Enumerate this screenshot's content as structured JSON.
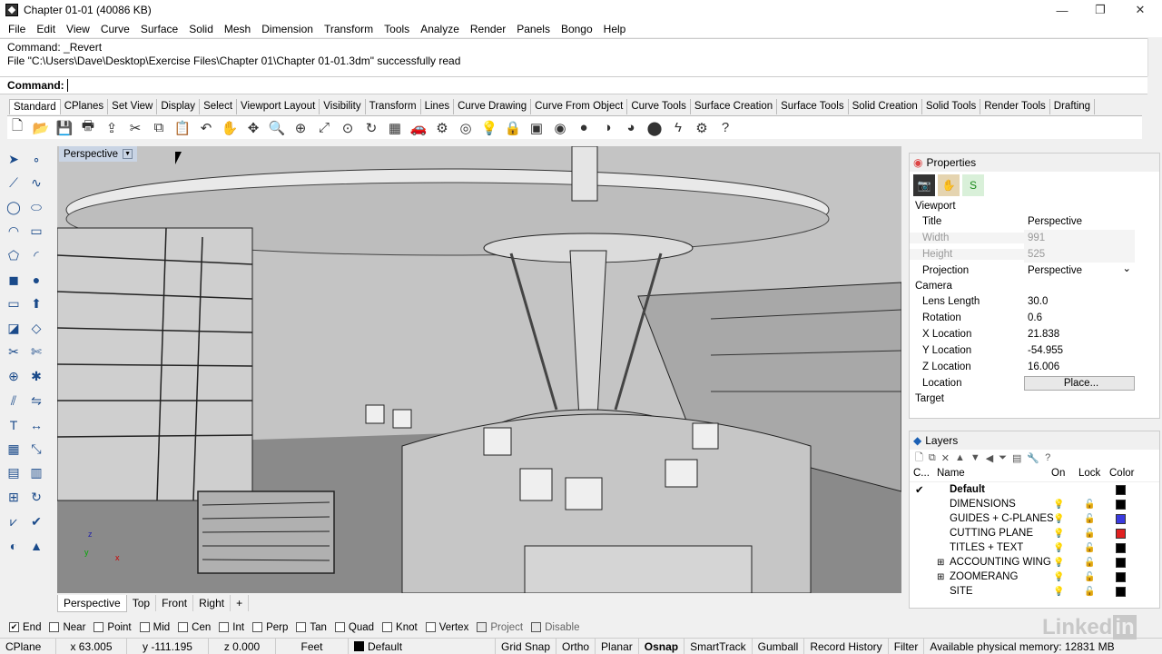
{
  "window": {
    "title": "Chapter 01-01 (40086 KB)",
    "minimize": "—",
    "restore": "❐",
    "close": "✕"
  },
  "menu": [
    "File",
    "Edit",
    "View",
    "Curve",
    "Surface",
    "Solid",
    "Mesh",
    "Dimension",
    "Transform",
    "Tools",
    "Analyze",
    "Render",
    "Panels",
    "Bongo",
    "Help"
  ],
  "command": {
    "history": [
      "Command: _Revert",
      "File \"C:\\Users\\Dave\\Desktop\\Exercise Files\\Chapter 01\\Chapter 01-01.3dm\" successfully read"
    ],
    "prompt": "Command:"
  },
  "toolbar_tabs": [
    "Standard",
    "CPlanes",
    "Set View",
    "Display",
    "Select",
    "Viewport Layout",
    "Visibility",
    "Transform",
    "Lines",
    "Curve Drawing",
    "Curve From Object",
    "Curve Tools",
    "Surface Creation",
    "Surface Tools",
    "Solid Creation",
    "Solid Tools",
    "Render Tools",
    "Drafting"
  ],
  "toolbar_icons": [
    "new-icon",
    "open-icon",
    "save-icon",
    "print-icon",
    "import-icon",
    "cut-icon",
    "copy-icon",
    "paste-icon",
    "undo-icon",
    "pan-icon",
    "move-icon",
    "zoom-icon",
    "zoom-window-icon",
    "zoom-extents-icon",
    "zoom-selected-icon",
    "rotate-view-icon",
    "four-viewports-icon",
    "car-icon",
    "render-options-icon",
    "cplane-icon",
    "light-icon",
    "lock-icon",
    "material-icon",
    "color-wheel-icon",
    "shade-icon",
    "rendered-icon",
    "ghosted-icon",
    "sphere-icon",
    "lightning-icon",
    "options-gear-icon",
    "help-icon"
  ],
  "toolbar_glyphs": [
    "🗋",
    "📂",
    "💾",
    "🖶",
    "⇪",
    "✂",
    "⧉",
    "📋",
    "↶",
    "✋",
    "✥",
    "🔍",
    "⊕",
    "⤢",
    "⊙",
    "↻",
    "▦",
    "🚗",
    "⚙",
    "◎",
    "💡",
    "🔒",
    "▣",
    "◉",
    "●",
    "◑",
    "◕",
    "⬤",
    "ϟ",
    "⚙",
    "?"
  ],
  "viewport": {
    "title": "Perspective",
    "dropdown": "▼",
    "axis": {
      "z": "z",
      "y": "y",
      "x": "x"
    }
  },
  "view_tabs": [
    "Perspective",
    "Top",
    "Front",
    "Right",
    "+"
  ],
  "properties": {
    "header": "Properties",
    "sections": {
      "viewport": "Viewport",
      "camera": "Camera",
      "target": "Target"
    },
    "viewport_rows": [
      {
        "k": "Title",
        "v": "Perspective"
      },
      {
        "k": "Width",
        "v": "991"
      },
      {
        "k": "Height",
        "v": "525"
      },
      {
        "k": "Projection",
        "v": "Perspective"
      }
    ],
    "camera_rows": [
      {
        "k": "Lens Length",
        "v": "30.0"
      },
      {
        "k": "Rotation",
        "v": "0.6"
      },
      {
        "k": "X Location",
        "v": "21.838"
      },
      {
        "k": "Y Location",
        "v": "-54.955"
      },
      {
        "k": "Z Location",
        "v": "16.006"
      },
      {
        "k": "Location",
        "v": "Place..."
      }
    ]
  },
  "layers": {
    "header": "Layers",
    "columns": [
      "C...",
      "Name",
      "On",
      "Lock",
      "Color"
    ],
    "rows": [
      {
        "name": "Default",
        "color": "#000000",
        "current": true
      },
      {
        "name": "DIMENSIONS",
        "color": "#000000",
        "on": "blue"
      },
      {
        "name": "GUIDES + C-PLANES",
        "color": "#3a3adf",
        "on": "blue"
      },
      {
        "name": "CUTTING PLANE",
        "color": "#e02020",
        "on": "blue"
      },
      {
        "name": "TITLES + TEXT",
        "color": "#000000"
      },
      {
        "name": "ACCOUNTING WING",
        "color": "#000000",
        "expand": true
      },
      {
        "name": "ZOOMERANG",
        "color": "#000000",
        "expand": true
      },
      {
        "name": "SITE",
        "color": "#000000"
      }
    ]
  },
  "osnap": [
    {
      "label": "End",
      "checked": true
    },
    {
      "label": "Near"
    },
    {
      "label": "Point"
    },
    {
      "label": "Mid"
    },
    {
      "label": "Cen"
    },
    {
      "label": "Int"
    },
    {
      "label": "Perp"
    },
    {
      "label": "Tan"
    },
    {
      "label": "Quad"
    },
    {
      "label": "Knot"
    },
    {
      "label": "Vertex"
    },
    {
      "label": "Project",
      "disabled": true
    },
    {
      "label": "Disable",
      "disabled": true
    }
  ],
  "status": {
    "cplane": "CPlane",
    "x": "x 63.005",
    "y": "y -111.195",
    "z": "z 0.000",
    "units": "Feet",
    "layer": "Default",
    "toggles": [
      "Grid Snap",
      "Ortho",
      "Planar",
      "Osnap",
      "SmartTrack",
      "Gumball",
      "Record History",
      "Filter"
    ],
    "memory": "Available physical memory: 12831 MB"
  },
  "watermark": "Linked in"
}
